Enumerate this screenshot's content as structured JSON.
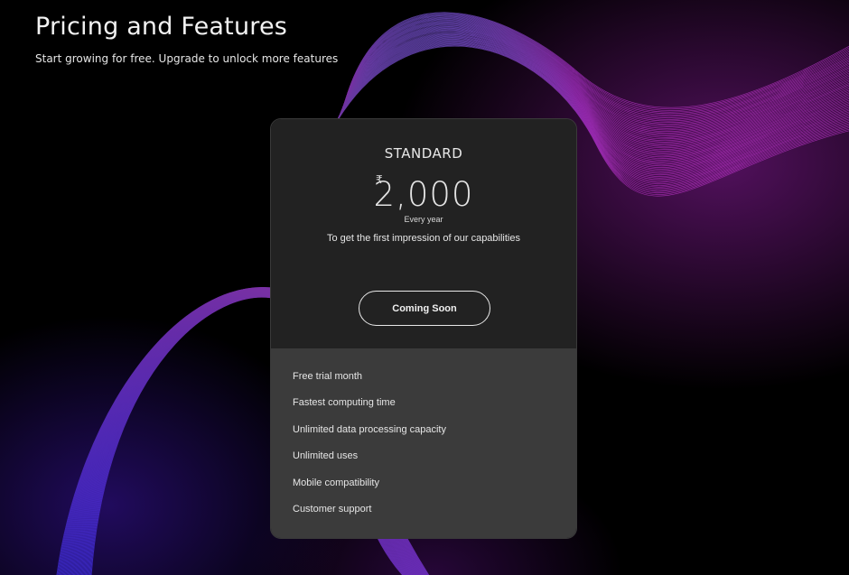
{
  "header": {
    "title": "Pricing and Features",
    "subtitle": "Start growing for free. Upgrade to unlock more features"
  },
  "plan": {
    "name": "STANDARD",
    "currency_symbol": "₹",
    "price": "2,000",
    "period": "Every year",
    "tagline": "To get the first impression of our capabilities",
    "cta_label": "Coming Soon",
    "features": [
      "Free trial month",
      "Fastest computing time",
      "Unlimited data processing capacity",
      "Unlimited uses",
      "Mobile compatibility",
      "Customer support"
    ]
  },
  "colors": {
    "background": "#000000",
    "card_top": "#222222",
    "card_bottom": "#3b3b3b",
    "accent_purple": "#9b2fd0",
    "accent_blue": "#3a1fd0"
  }
}
